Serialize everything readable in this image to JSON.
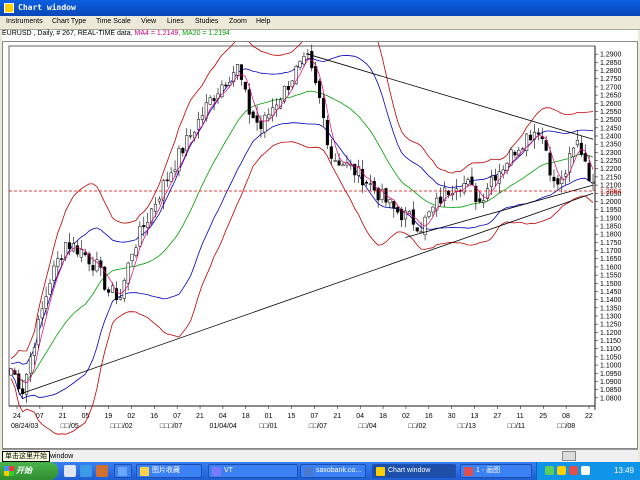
{
  "window": {
    "title": "Chart window"
  },
  "menu": [
    "Instruments",
    "Chart Type",
    "Time Scale",
    "View",
    "Lines",
    "Studies",
    "Zoom",
    "Help"
  ],
  "legend": {
    "symbol_text": "EURUSD , Daily, # 267, REAL-TIME data",
    "ma4": ", MA4 = 1.2149",
    "ma20": ", MA20 = 1.2194"
  },
  "colors": {
    "candle": "#000000",
    "bollinger": "#c00000",
    "outer_band": "#0000c0",
    "ma20": "#00a000",
    "ma4": "#e0007a",
    "current_line": "#e00000"
  },
  "chart_data": {
    "type": "candlestick",
    "ylim": [
      1.075,
      1.295
    ],
    "yticks": [
      "1.2900",
      "1.2850",
      "1.2800",
      "1.2750",
      "1.2700",
      "1.2650",
      "1.2600",
      "1.2550",
      "1.2500",
      "1.2450",
      "1.2400",
      "1.2350",
      "1.2300",
      "1.2250",
      "1.2200",
      "1.2150",
      "1.2100",
      "1.2050",
      "1.2000",
      "1.1950",
      "1.1900",
      "1.1850",
      "1.1800",
      "1.1750",
      "1.1700",
      "1.1650",
      "1.1600",
      "1.1550",
      "1.1500",
      "1.1450",
      "1.1400",
      "1.1350",
      "1.1300",
      "1.1250",
      "1.1200",
      "1.1150",
      "1.1100",
      "1.1050",
      "1.1000",
      "1.0950",
      "1.0900",
      "1.0850",
      "1.0800"
    ],
    "current_price": "1.2064",
    "current_value": 1.2064,
    "xticks_top": [
      "24",
      "07",
      "21",
      "05",
      "19",
      "02",
      "16",
      "07",
      "21",
      "04",
      "18",
      "01",
      "15",
      "07",
      "21",
      "04",
      "18",
      "02",
      "16",
      "30",
      "13",
      "27",
      "11",
      "25",
      "08",
      "22"
    ],
    "xticks_bottom": [
      "08/24/03",
      "□□/05",
      "□□□/02",
      "□□□/07",
      "01/04/04",
      "□□/01",
      "□□/07",
      "□□/04",
      "□□/02",
      "□□/13",
      "□□/11",
      "□□/08"
    ],
    "close_points": [
      [
        0,
        1.098
      ],
      [
        3,
        1.085
      ],
      [
        6,
        1.115
      ],
      [
        10,
        1.152
      ],
      [
        14,
        1.175
      ],
      [
        18,
        1.17
      ],
      [
        22,
        1.16
      ],
      [
        25,
        1.145
      ],
      [
        28,
        1.142
      ],
      [
        31,
        1.17
      ],
      [
        35,
        1.19
      ],
      [
        39,
        1.21
      ],
      [
        43,
        1.228
      ],
      [
        47,
        1.245
      ],
      [
        51,
        1.262
      ],
      [
        55,
        1.275
      ],
      [
        58,
        1.282
      ],
      [
        61,
        1.255
      ],
      [
        64,
        1.245
      ],
      [
        67,
        1.258
      ],
      [
        70,
        1.268
      ],
      [
        73,
        1.28
      ],
      [
        76,
        1.286
      ],
      [
        79,
        1.262
      ],
      [
        82,
        1.228
      ],
      [
        86,
        1.222
      ],
      [
        90,
        1.215
      ],
      [
        94,
        1.205
      ],
      [
        98,
        1.195
      ],
      [
        102,
        1.19
      ],
      [
        105,
        1.185
      ],
      [
        108,
        1.195
      ],
      [
        111,
        1.205
      ],
      [
        114,
        1.212
      ],
      [
        117,
        1.21
      ],
      [
        120,
        1.2
      ],
      [
        123,
        1.215
      ],
      [
        126,
        1.222
      ],
      [
        129,
        1.232
      ],
      [
        132,
        1.24
      ],
      [
        135,
        1.245
      ],
      [
        137,
        1.232
      ],
      [
        139,
        1.21
      ],
      [
        141,
        1.212
      ],
      [
        143,
        1.225
      ],
      [
        145,
        1.236
      ],
      [
        147,
        1.226
      ],
      [
        149,
        1.208
      ]
    ],
    "trendlines": [
      {
        "from": [
          2,
          1.082
        ],
        "to": [
          149,
          1.205
        ]
      },
      {
        "from": [
          76,
          1.29
        ],
        "to": [
          149,
          1.238
        ]
      },
      {
        "from": [
          101,
          1.178
        ],
        "to": [
          149,
          1.21
        ]
      }
    ]
  },
  "status": {
    "tooltip": "单击这里开始",
    "window_label": "window"
  },
  "taskbar": {
    "start_label": "开始",
    "tasks": [
      {
        "label": "",
        "color": "#6aa8ff"
      },
      {
        "label": "图片收藏",
        "color": "#ffd24a"
      },
      {
        "label": "VT",
        "color": "#7a7aff"
      },
      {
        "label": "saxobank.co...",
        "color": "#4a7ad0"
      },
      {
        "label": "Chart window",
        "color": "#ffd000"
      },
      {
        "label": "1 - 画图",
        "color": "#e05050"
      }
    ],
    "clock": "13:49"
  }
}
